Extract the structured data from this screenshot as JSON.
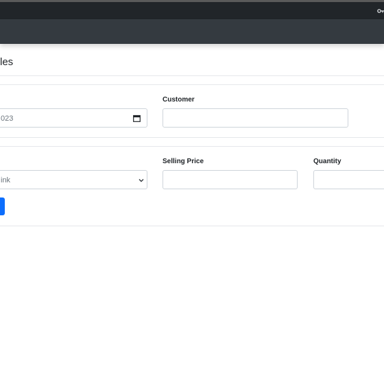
{
  "page": {
    "title": "les"
  },
  "form": {
    "date": {
      "value": "023"
    },
    "customer": {
      "label": "Customer",
      "value": ""
    },
    "product": {
      "value": "ink"
    },
    "selling_price": {
      "label": "Selling Price",
      "value": ""
    },
    "quantity": {
      "label": "Quantity",
      "value": ""
    }
  },
  "icons": {
    "key": "key-icon",
    "calendar": "calendar-icon",
    "chevron": "chevron-down-icon"
  },
  "colors": {
    "topbar": "#212529",
    "subbar": "#343a40",
    "primary_button": "#0d6efd"
  }
}
